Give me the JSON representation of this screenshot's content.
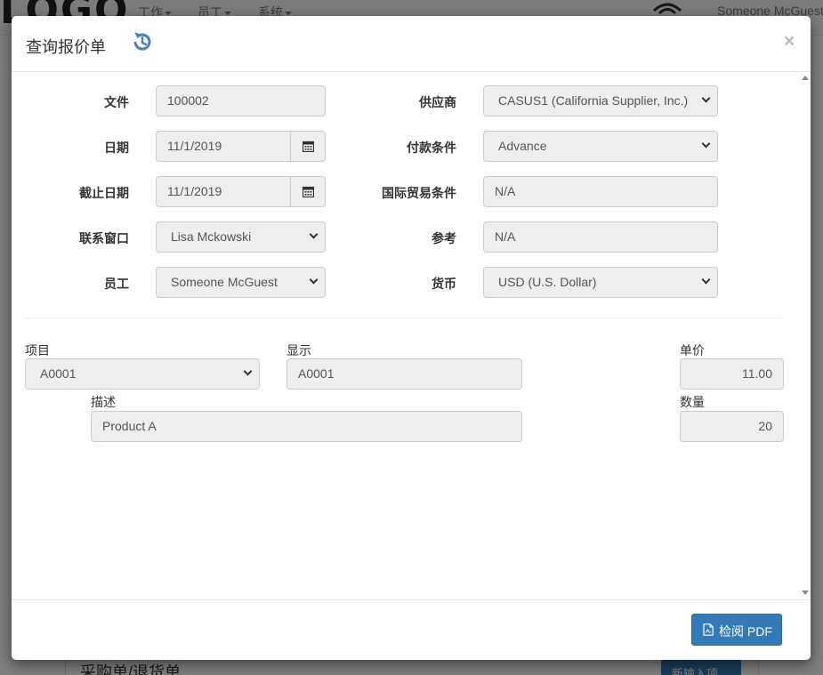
{
  "background": {
    "logo": "LOGO",
    "nav": [
      {
        "label": "工作"
      },
      {
        "label": "员工"
      },
      {
        "label": "系统"
      }
    ],
    "user": "Someone McGuest",
    "panel_title": "采购单/退货单",
    "panel_button": "新输入项"
  },
  "modal": {
    "title": "查询报价单",
    "close": "×",
    "fields": {
      "document": {
        "label": "文件",
        "value": "100002"
      },
      "date": {
        "label": "日期",
        "value": "11/1/2019"
      },
      "due_date": {
        "label": "截止日期",
        "value": "11/1/2019"
      },
      "contact": {
        "label": "联系窗口",
        "value": "Lisa Mckowski"
      },
      "employee": {
        "label": "员工",
        "value": "Someone McGuest"
      },
      "supplier": {
        "label": "供应商",
        "value": "CASUS1 (California Supplier, Inc.)"
      },
      "payment_terms": {
        "label": "付款条件",
        "value": "Advance"
      },
      "incoterms": {
        "label": "国际贸易条件",
        "value": "N/A"
      },
      "reference": {
        "label": "参考",
        "value": "N/A"
      },
      "currency": {
        "label": "货币",
        "value": "USD (U.S. Dollar)"
      }
    },
    "line": {
      "item": {
        "label": "项目",
        "value": "A0001"
      },
      "display": {
        "label": "显示",
        "value": "A0001"
      },
      "unit_price": {
        "label": "单价",
        "value": "11.00"
      },
      "description": {
        "label": "描述",
        "value": "Product A"
      },
      "quantity": {
        "label": "数量",
        "value": "20"
      }
    },
    "footer": {
      "pdf_button": "检阅 PDF"
    }
  },
  "colors": {
    "primary": "#337ab7",
    "field_bg": "#eeeeee"
  }
}
